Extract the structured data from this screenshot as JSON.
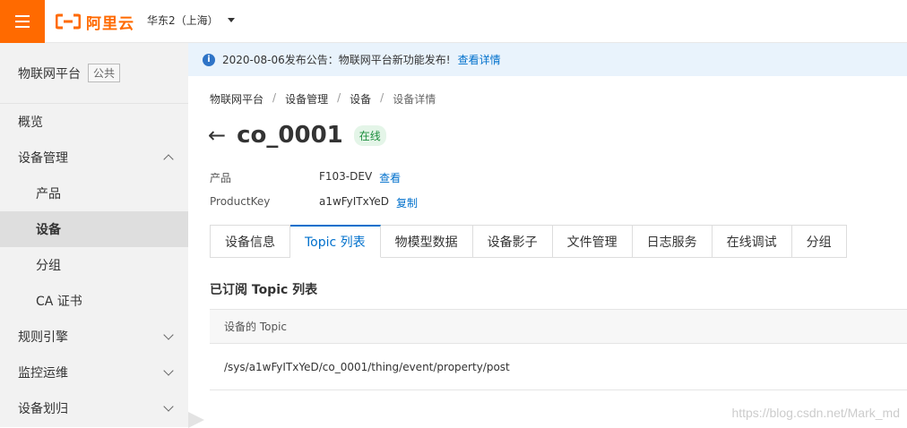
{
  "topbar": {
    "logo_text": "阿里云",
    "region": "华东2（上海）",
    "brand_color": "#ff6a00"
  },
  "sidebar": {
    "title": "物联网平台",
    "tag": "公共",
    "items": [
      {
        "label": "概览"
      },
      {
        "label": "设备管理",
        "expanded": true
      },
      {
        "label": "产品"
      },
      {
        "label": "设备",
        "active": true
      },
      {
        "label": "分组"
      },
      {
        "label": "CA 证书"
      },
      {
        "label": "规则引擎"
      },
      {
        "label": "监控运维"
      },
      {
        "label": "设备划归"
      }
    ]
  },
  "notice": {
    "text": "2020-08-06发布公告：物联网平台新功能发布!",
    "link": "查看详情"
  },
  "breadcrumb": [
    "物联网平台",
    "设备管理",
    "设备",
    "设备详情"
  ],
  "device": {
    "name": "co_0001",
    "status": "在线",
    "product_label": "产品",
    "product_value": "F103-DEV",
    "product_link": "查看",
    "key_label": "ProductKey",
    "key_value": "a1wFyITxYeD",
    "key_link": "复制"
  },
  "tabs": [
    {
      "label": "设备信息"
    },
    {
      "label": "Topic 列表",
      "active": true
    },
    {
      "label": "物模型数据"
    },
    {
      "label": "设备影子"
    },
    {
      "label": "文件管理"
    },
    {
      "label": "日志服务"
    },
    {
      "label": "在线调试"
    },
    {
      "label": "分组"
    }
  ],
  "topic_section": {
    "title": "已订阅 Topic 列表",
    "column": "设备的 Topic",
    "rows": [
      "/sys/a1wFyITxYeD/co_0001/thing/event/property/post"
    ]
  },
  "watermark": "https://blog.csdn.net/Mark_md"
}
